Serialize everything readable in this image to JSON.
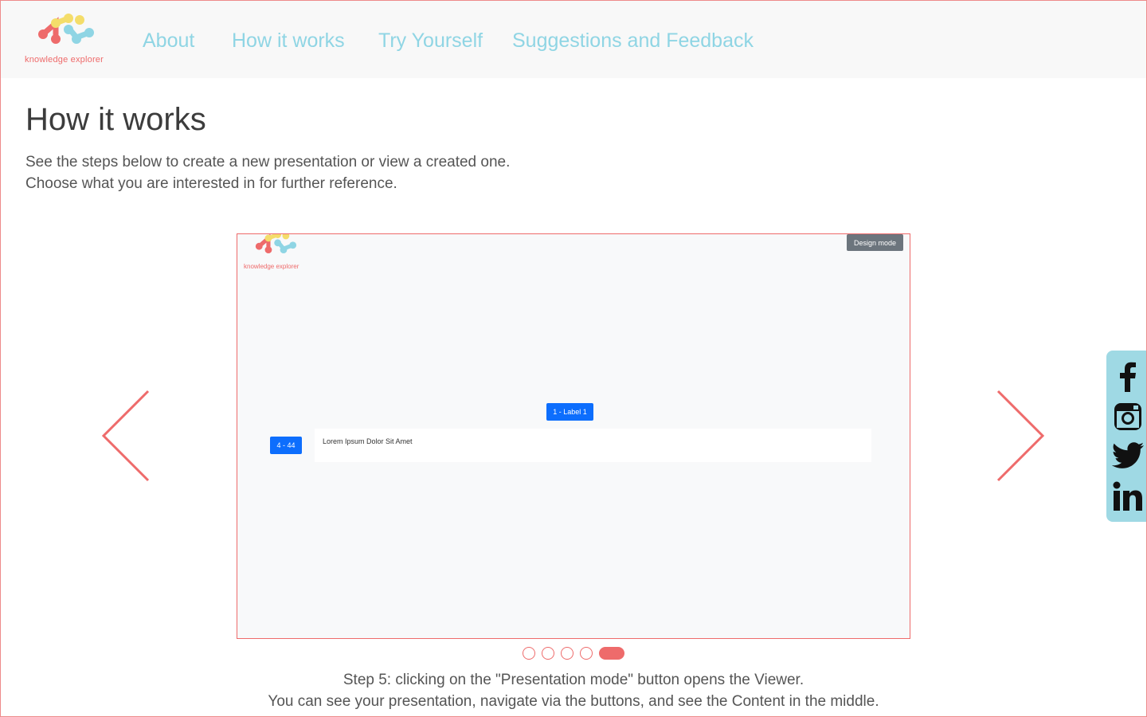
{
  "brand": {
    "logo_text": "knowledge explorer",
    "primary": "#ee6b6b",
    "accent": "#8fd5e4"
  },
  "nav": {
    "about": "About",
    "how_it_works": "How it works",
    "try_yourself": "Try Yourself",
    "feedback": "Suggestions and Feedback"
  },
  "main": {
    "title": "How it works",
    "intro_line1": "See the steps below to create a new presentation or view a created one.",
    "intro_line2": "Choose what you are interested in for further reference."
  },
  "slide": {
    "logo_text": "knowledge explorer",
    "design_mode_label": "Design mode",
    "label_button": "1 - Label 1",
    "nav_button": "4 - 44",
    "content_text": "Lorem Ipsum Dolor Sit Amet"
  },
  "carousel": {
    "slide_count": 5,
    "active_slide": 5,
    "caption_line1": "Step 5: clicking on the \"Presentation mode\" button opens the Viewer.",
    "caption_line2": "You can see your presentation, navigate via the buttons, and see the Content in the middle.",
    "prev_icon": "chevron-left-icon",
    "next_icon": "chevron-right-icon"
  },
  "social": [
    "facebook-icon",
    "instagram-icon",
    "twitter-icon",
    "linkedin-icon"
  ]
}
